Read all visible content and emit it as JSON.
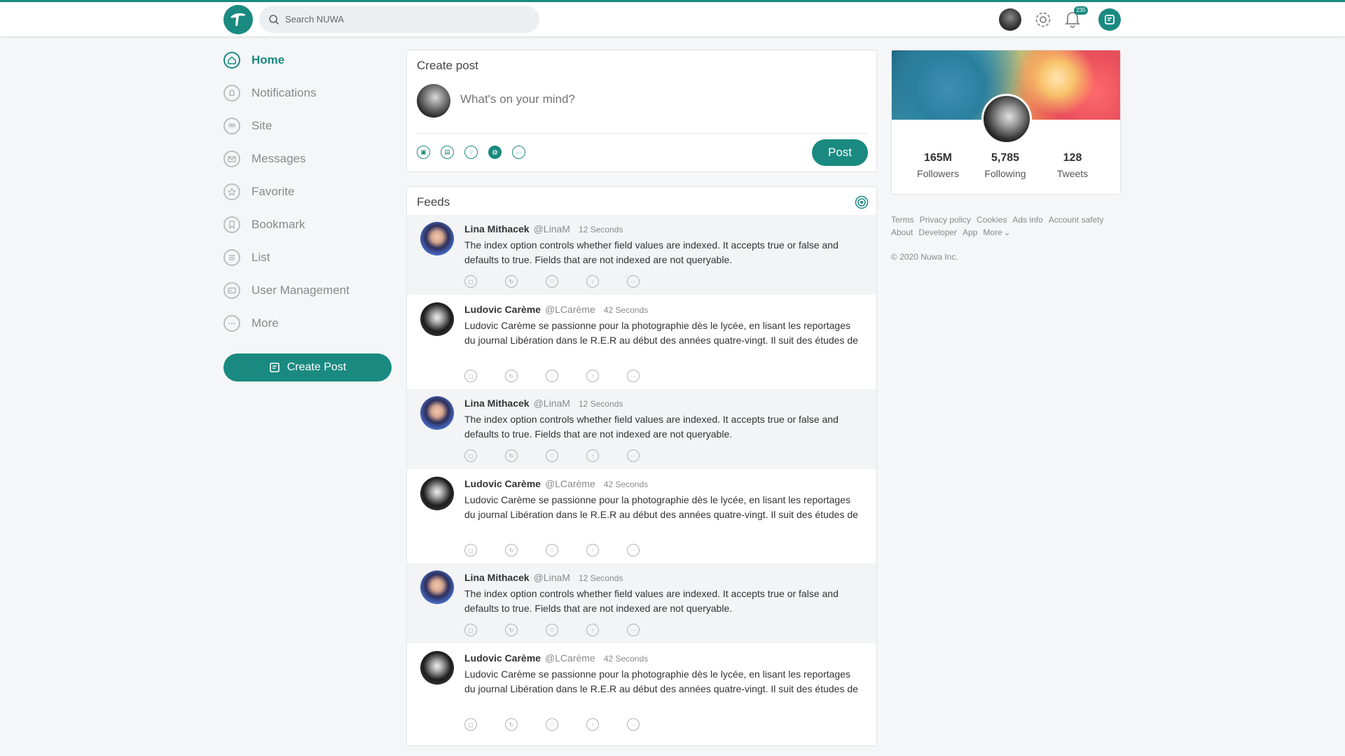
{
  "header": {
    "search_placeholder": "Search NUWA",
    "notification_count": "235"
  },
  "sidebar": {
    "items": [
      {
        "label": "Home"
      },
      {
        "label": "Notifications"
      },
      {
        "label": "Site"
      },
      {
        "label": "Messages"
      },
      {
        "label": "Favorite"
      },
      {
        "label": "Bookmark"
      },
      {
        "label": "List"
      },
      {
        "label": "User Management"
      },
      {
        "label": "More"
      }
    ],
    "create_post_label": "Create Post"
  },
  "create_post": {
    "title": "Create post",
    "placeholder": "What's on your mind?",
    "post_label": "Post"
  },
  "feeds": {
    "title": "Feeds",
    "items": [
      {
        "name": "Lina Mithacek",
        "handle": "@LinaM",
        "time": "12 Seconds",
        "text": "The index option controls whether field values are indexed. It accepts true or false and defaults to true. Fields that are not indexed are not queryable."
      },
      {
        "name": "Ludovic Carème",
        "handle": "@LCarème",
        "time": "42 Seconds",
        "text": "Ludovic Carème se passionne pour la photographie dès le lycée, en lisant les reportages du journal Libération dans le R.E.R au début des années quatre-vingt. Il suit des études de"
      },
      {
        "name": "Lina Mithacek",
        "handle": "@LinaM",
        "time": "12 Seconds",
        "text": "The index option controls whether field values are indexed. It accepts true or false and defaults to true. Fields that are not indexed are not queryable."
      },
      {
        "name": "Ludovic Carème",
        "handle": "@LCarème",
        "time": "42 Seconds",
        "text": "Ludovic Carème se passionne pour la photographie dès le lycée, en lisant les reportages du journal Libération dans le R.E.R au début des années quatre-vingt. Il suit des études de"
      },
      {
        "name": "Lina Mithacek",
        "handle": "@LinaM",
        "time": "12 Seconds",
        "text": "The index option controls whether field values are indexed. It accepts true or false and defaults to true. Fields that are not indexed are not queryable."
      },
      {
        "name": "Ludovic Carème",
        "handle": "@LCarème",
        "time": "42 Seconds",
        "text": "Ludovic Carème se passionne pour la photographie dès le lycée, en lisant les reportages du journal Libération dans le R.E.R au début des années quatre-vingt. Il suit des études de"
      }
    ]
  },
  "profile": {
    "followers_count": "165M",
    "followers_label": "Followers",
    "following_count": "5,785",
    "following_label": "Following",
    "tweets_count": "128",
    "tweets_label": "Tweets"
  },
  "footer": {
    "links": [
      "Terms",
      "Privacy policy",
      "Cookies",
      "Ads info",
      "Account safety",
      "About",
      "Developer",
      "App",
      "More"
    ],
    "copyright": "© 2020 Nuwa Inc."
  },
  "theme": {
    "accent": "#1a8a80"
  }
}
